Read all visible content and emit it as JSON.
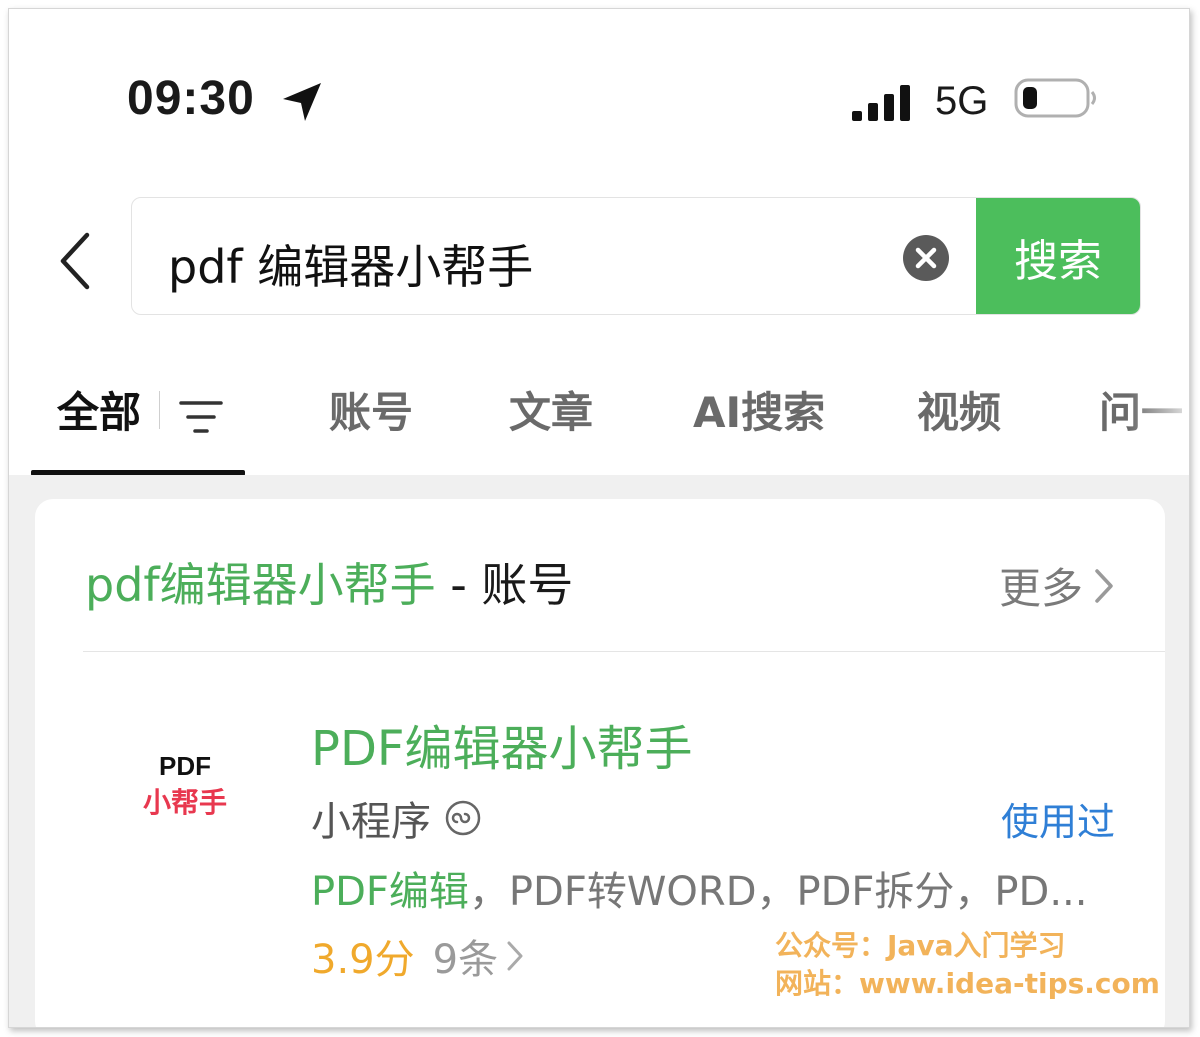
{
  "status_bar": {
    "time": "09:30",
    "location_icon": "location-arrow-icon",
    "signal_icon": "cellular-signal-icon",
    "network": "5G",
    "battery_icon": "battery-low-icon"
  },
  "search": {
    "back_icon": "chevron-left-icon",
    "query": "pdf 编辑器小帮手",
    "clear_icon": "clear-circle-icon",
    "button_label": "搜索",
    "button_color": "#4cbe5c"
  },
  "tabs": {
    "items": [
      {
        "label": "全部",
        "active": true
      },
      {
        "label": "账号",
        "active": false
      },
      {
        "label": "文章",
        "active": false
      },
      {
        "label": "AI搜索",
        "active": false
      },
      {
        "label": "视频",
        "active": false
      },
      {
        "label": "问一",
        "active": false
      }
    ],
    "filter_icon": "filter-lines-icon"
  },
  "account_section": {
    "title_highlight": "pdf编辑器小帮手",
    "title_suffix": " - 账号",
    "more_label": "更多",
    "highlight_color": "#4cae5a"
  },
  "result": {
    "logo_line1": "PDF",
    "logo_line2": "小帮手",
    "title": "PDF编辑器小帮手",
    "type_label": "小程序",
    "type_icon": "mini-program-icon",
    "used_badge": "使用过",
    "desc_highlight": "PDF编辑",
    "desc_rest": "，PDF转WORD，PDF拆分，PD...",
    "rating_score": "3.9分",
    "rating_count": "9条",
    "rating_color": "#f0a92c"
  },
  "watermark": {
    "line1": "公众号：Java入门学习",
    "line2": "网站：www.idea-tips.com"
  }
}
